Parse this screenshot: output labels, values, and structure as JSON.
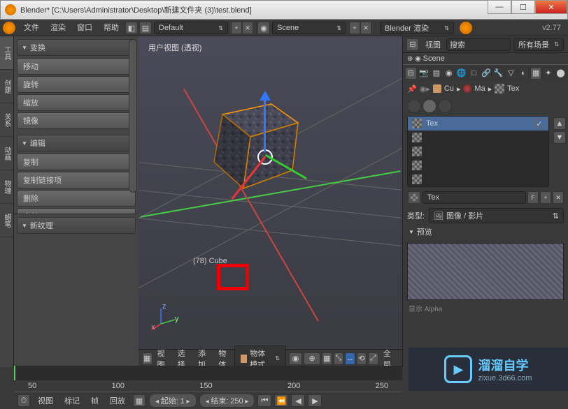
{
  "window": {
    "title": "Blender* [C:\\Users\\Administrator\\Desktop\\新建文件夹 (3)\\test.blend]"
  },
  "topmenu": {
    "file": "文件",
    "render": "渲染",
    "window": "窗口",
    "help": "帮助",
    "layout": "Default",
    "scene": "Scene",
    "engine": "Blender 渲染",
    "version": "v2.77"
  },
  "left_tabs": {
    "t0": "工具",
    "t1": "创建",
    "t2": "关系",
    "t3": "动画",
    "t4": "物理",
    "t5": "蜡笔"
  },
  "tool_panel": {
    "transform_hdr": "变换",
    "move": "移动",
    "rotate": "旋转",
    "scale": "缩放",
    "mirror": "镜像",
    "edit_hdr": "编辑",
    "copy": "复制",
    "copy_link": "复制链接项",
    "delete": "删除",
    "merge": "合并",
    "new_tex_hdr": "新纹理"
  },
  "viewport": {
    "label": "用户视图  (透视)",
    "object": "(78) Cube",
    "ax_x": "x",
    "ax_y": "y",
    "ax_z": "z"
  },
  "viewport_header": {
    "view": "视图",
    "select": "选择",
    "add": "添加",
    "object": "物体",
    "mode": "物体模式",
    "global": "全局"
  },
  "outliner": {
    "view": "视图",
    "search": "搜索",
    "filter": "所有场景",
    "item": "Scene"
  },
  "props": {
    "bc_obj": "Cu",
    "bc_mat": "Ma",
    "bc_tex": "Tex",
    "slot_name": "Tex",
    "tex_name": "Tex",
    "f_btn": "F",
    "type_lbl": "类型:",
    "type_val": "图像 / 影片",
    "preview_hdr": "预览",
    "alpha": "显示 Alpha"
  },
  "timeline": {
    "view": "视图",
    "marker": "标记",
    "frame": "帧",
    "playback": "回放",
    "start_lbl": "起始:",
    "start_val": "1",
    "end_lbl": "结束:",
    "end_val": "250",
    "ticks": [
      "50",
      "100",
      "150",
      "200",
      "250"
    ]
  },
  "watermark": {
    "brand": "溜溜自学",
    "url": "zixue.3d66.com"
  }
}
